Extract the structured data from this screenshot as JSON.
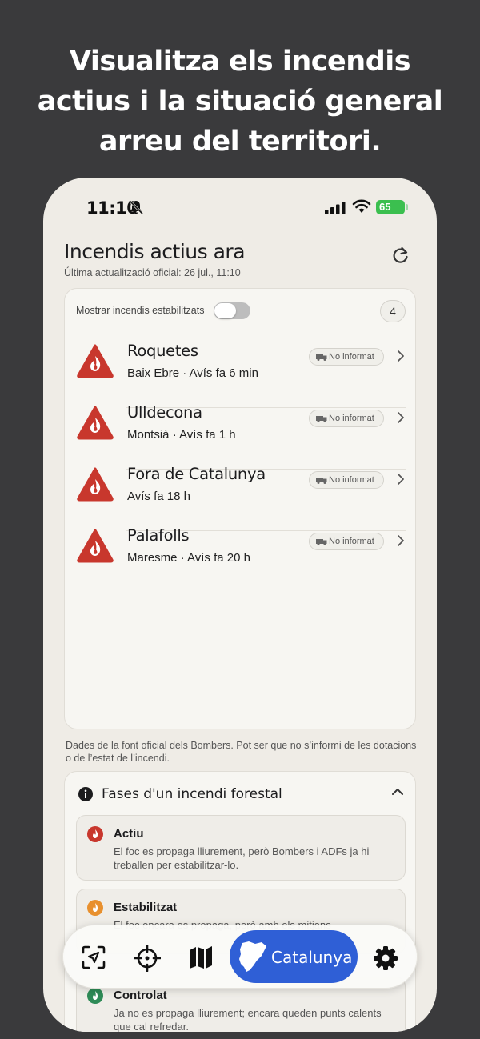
{
  "headline": [
    "Visualitza els incendis",
    "actius i la situació general",
    "arreu del territori."
  ],
  "status_bar": {
    "time": "11:10",
    "battery": "65"
  },
  "header": {
    "title": "Incendis actius ara",
    "updated": "Última actualització oficial: 26 jul., 11:10"
  },
  "card": {
    "toggle_label": "Mostrar incendis estabilitzats",
    "toggle_on": false,
    "count": "4",
    "incidents": [
      {
        "name": "Roquetes",
        "sub": "Baix Ebre · Avís fa 6 min",
        "status": "No informat"
      },
      {
        "name": "Ulldecona",
        "sub": "Montsià · Avís fa 1 h",
        "status": "No informat"
      },
      {
        "name": "Fora de Catalunya",
        "sub": "Avís fa 18 h",
        "status": "No informat"
      },
      {
        "name": "Palafolls",
        "sub": "Maresme · Avís fa 20 h",
        "status": "No informat"
      }
    ]
  },
  "note": "Dades de la font oficial dels Bombers. Pot ser que no s’informi de les dotacions o de l’estat de l’incendi.",
  "phases": {
    "title": "Fases d'un incendi forestal",
    "items": [
      {
        "name": "Actiu",
        "desc": "El foc es propaga lliurement, però Bombers i ADFs ja hi treballen per estabilitzar-lo.",
        "color": "#c8372d"
      },
      {
        "name": "Estabilitzat",
        "desc": "El foc encara es propaga, però amb els mitjans",
        "color": "#e8902e"
      },
      {
        "name": "Controlat",
        "desc": "Ja no es propaga lliurement; encara queden punts calents que cal refredar.",
        "color": "#2e8b57"
      }
    ]
  },
  "tabbar": {
    "active_label": "Catalunya",
    "active_color": "#2f5fd6"
  },
  "colors": {
    "alert_red": "#c8372d",
    "background": "#3a3a3c",
    "surface": "#efece6"
  }
}
